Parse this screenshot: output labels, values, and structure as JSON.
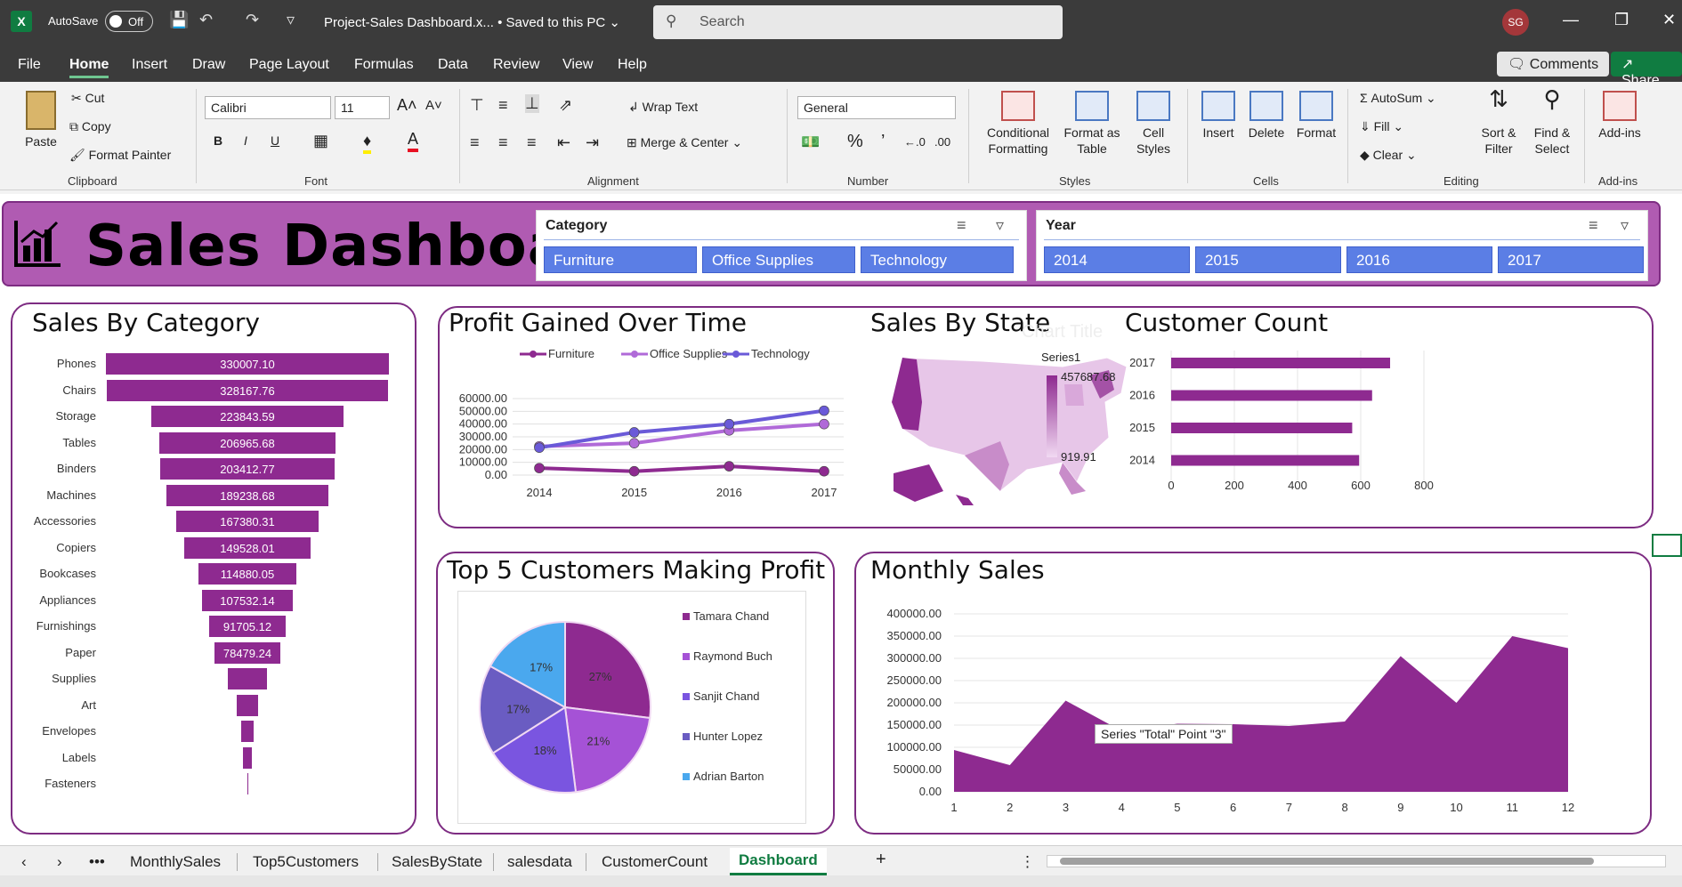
{
  "titlebar": {
    "logo": "X",
    "autosave_label": "AutoSave",
    "autosave_state": "Off",
    "filename": "Project-Sales Dashboard.x...",
    "saved_status": "• Saved to this PC",
    "search_placeholder": "Search",
    "user_initials": "SG"
  },
  "menu": {
    "tabs": [
      "File",
      "Home",
      "Insert",
      "Draw",
      "Page Layout",
      "Formulas",
      "Data",
      "Review",
      "View",
      "Help"
    ],
    "active_tab": "Home",
    "comments_label": "Comments",
    "share_label": "Share"
  },
  "ribbon": {
    "clipboard": {
      "paste": "Paste",
      "cut": "Cut",
      "copy": "Copy",
      "format_painter": "Format Painter",
      "label": "Clipboard"
    },
    "font": {
      "name": "Calibri",
      "size": "11",
      "label": "Font",
      "bold": "B",
      "italic": "I",
      "underline": "U"
    },
    "alignment": {
      "wrap_text": "Wrap Text",
      "merge_center": "Merge & Center",
      "label": "Alignment"
    },
    "number": {
      "format": "General",
      "label": "Number"
    },
    "styles": {
      "conditional": "Conditional Formatting",
      "format_table": "Format as Table",
      "cell_styles": "Cell Styles",
      "label": "Styles"
    },
    "cells": {
      "insert": "Insert",
      "delete": "Delete",
      "format": "Format",
      "label": "Cells"
    },
    "editing": {
      "autosum": "AutoSum",
      "fill": "Fill",
      "clear": "Clear",
      "sort_filter": "Sort & Filter",
      "find_select": "Find & Select",
      "label": "Editing"
    },
    "addins": {
      "addins": "Add-ins",
      "label": "Add-ins"
    }
  },
  "dashboard": {
    "title": "Sales Dashboard",
    "category_slicer": {
      "header": "Category",
      "items": [
        "Furniture",
        "Office Supplies",
        "Technology"
      ]
    },
    "year_slicer": {
      "header": "Year",
      "items": [
        "2014",
        "2015",
        "2016",
        "2017"
      ]
    }
  },
  "panels": {
    "sales_by_category": "Sales By Category",
    "profit_over_time": "Profit Gained Over Time",
    "sales_by_state": "Sales By State",
    "sales_by_state_overlay": "Chart Title",
    "customer_count": "Customer Count",
    "top5": "Top 5 Customers Making Profit",
    "monthly_sales": "Monthly Sales"
  },
  "chart_data": [
    {
      "type": "bar",
      "title": "Sales By Category",
      "categories": [
        "Phones",
        "Chairs",
        "Storage",
        "Tables",
        "Binders",
        "Machines",
        "Accessories",
        "Copiers",
        "Bookcases",
        "Appliances",
        "Furnishings",
        "Paper",
        "Supplies",
        "Art",
        "Envelopes",
        "Labels",
        "Fasteners"
      ],
      "values": [
        330007.1,
        328167.76,
        223843.59,
        206965.68,
        203412.77,
        189238.68,
        167380.31,
        149528.01,
        114880.05,
        107532.14,
        91705.12,
        78479.24,
        46673.54,
        27118.79,
        16476.4,
        12486.31,
        3024.28
      ],
      "value_labels": [
        "330007.10",
        "328167.76",
        "223843.59",
        "206965.68",
        "203412.77",
        "189238.68",
        "167380.31",
        "149528.01",
        "114880.05",
        "107532.14",
        "91705.12",
        "78479.24",
        "",
        "",
        "",
        "",
        ""
      ],
      "orientation": "funnel"
    },
    {
      "type": "line",
      "title": "Profit Gained Over Time",
      "categories": [
        "2014",
        "2015",
        "2016",
        "2017"
      ],
      "series": [
        {
          "name": "Furniture",
          "values": [
            5500,
            3000,
            6900,
            3000
          ],
          "color": "#8e2a90"
        },
        {
          "name": "Office Supplies",
          "values": [
            22500,
            25000,
            35000,
            40000
          ],
          "color": "#b06ad8"
        },
        {
          "name": "Technology",
          "values": [
            21500,
            33500,
            40000,
            50500
          ],
          "color": "#6a5ad8"
        }
      ],
      "y_ticks": [
        "60000.00",
        "50000.00",
        "40000.00",
        "30000.00",
        "20000.00",
        "10000.00",
        "0.00"
      ],
      "ylim": [
        0,
        60000
      ],
      "legend": "top"
    },
    {
      "type": "heatmap",
      "title": "Sales By State",
      "legend_title": "Series1",
      "max_label": "457687.68",
      "min_label": "919.91"
    },
    {
      "type": "bar",
      "title": "Customer Count",
      "categories": [
        "2017",
        "2016",
        "2015",
        "2014"
      ],
      "values": [
        693,
        636,
        573,
        595
      ],
      "x_ticks": [
        "0",
        "200",
        "400",
        "600",
        "800"
      ],
      "xlim": [
        0,
        800
      ],
      "orientation": "horizontal"
    },
    {
      "type": "pie",
      "title": "Top 5 Customers Making Profit",
      "categories": [
        "Tamara Chand",
        "Raymond Buch",
        "Sanjit Chand",
        "Hunter Lopez",
        "Adrian Barton"
      ],
      "values": [
        27,
        21,
        18,
        17,
        17
      ],
      "labels": [
        "27%",
        "21%",
        "18%",
        "17%",
        "17%"
      ],
      "colors": [
        "#8e2a90",
        "#a552d6",
        "#7a55e0",
        "#6a5cc2",
        "#4aa8ee"
      ]
    },
    {
      "type": "area",
      "title": "Monthly Sales",
      "x": [
        "1",
        "2",
        "3",
        "4",
        "5",
        "6",
        "7",
        "8",
        "9",
        "10",
        "11",
        "12"
      ],
      "values": [
        94000,
        60000,
        205000,
        137000,
        153000,
        152000,
        148000,
        158000,
        305000,
        200000,
        350000,
        323000
      ],
      "y_ticks": [
        "400000.00",
        "350000.00",
        "300000.00",
        "250000.00",
        "200000.00",
        "150000.00",
        "100000.00",
        "50000.00",
        "0.00"
      ],
      "ylim": [
        0,
        400000
      ],
      "tooltip": "Series \"Total\" Point \"3\"",
      "color": "#8e2a90"
    }
  ],
  "sheet_tabs": {
    "tabs": [
      "MonthlySales",
      "Top5Customers",
      "SalesByState",
      "salesdata",
      "CustomerCount",
      "Dashboard"
    ],
    "active": "Dashboard",
    "add": "+",
    "more": "•••"
  }
}
